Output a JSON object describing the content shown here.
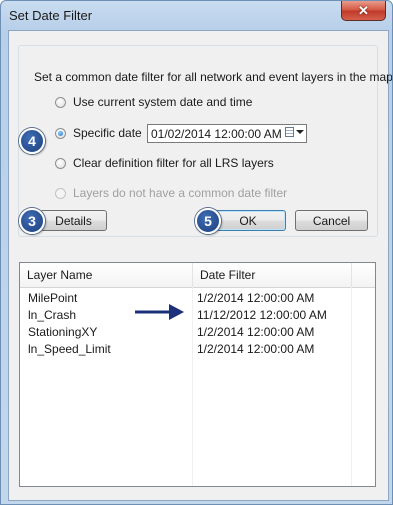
{
  "window": {
    "title": "Set Date Filter",
    "close_icon": "close-icon"
  },
  "group": {
    "caption": "Set a common date filter for all network and event layers in the map",
    "options": [
      {
        "label": "Use current system date and time",
        "selected": false,
        "enabled": true
      },
      {
        "label": "Specific date",
        "selected": true,
        "enabled": true
      },
      {
        "label": "Clear definition filter for all LRS layers",
        "selected": false,
        "enabled": true
      },
      {
        "label": "Layers do not have a common date filter",
        "selected": false,
        "enabled": false
      }
    ],
    "date_value": "01/02/2014 12:00:00 AM",
    "calendar_icon": "calendar-icon"
  },
  "buttons": {
    "details": "Details",
    "ok": "OK",
    "cancel": "Cancel"
  },
  "callouts": {
    "badge_3": "3",
    "badge_4": "4",
    "badge_5": "5",
    "arrow_icon": "arrow-right-icon"
  },
  "table": {
    "columns": [
      "Layer Name",
      "Date Filter"
    ],
    "rows": [
      {
        "layer": "MilePoint",
        "date": "1/2/2014 12:00:00 AM"
      },
      {
        "layer": "ln_Crash",
        "date": "11/12/2012 12:00:00 AM"
      },
      {
        "layer": "StationingXY",
        "date": "1/2/2014 12:00:00 AM"
      },
      {
        "layer": "ln_Speed_Limit",
        "date": "1/2/2014 12:00:00 AM"
      }
    ]
  },
  "colors": {
    "badge": "#1c3f7e",
    "arrow": "#1c2f7a",
    "close": "#c0392b"
  }
}
